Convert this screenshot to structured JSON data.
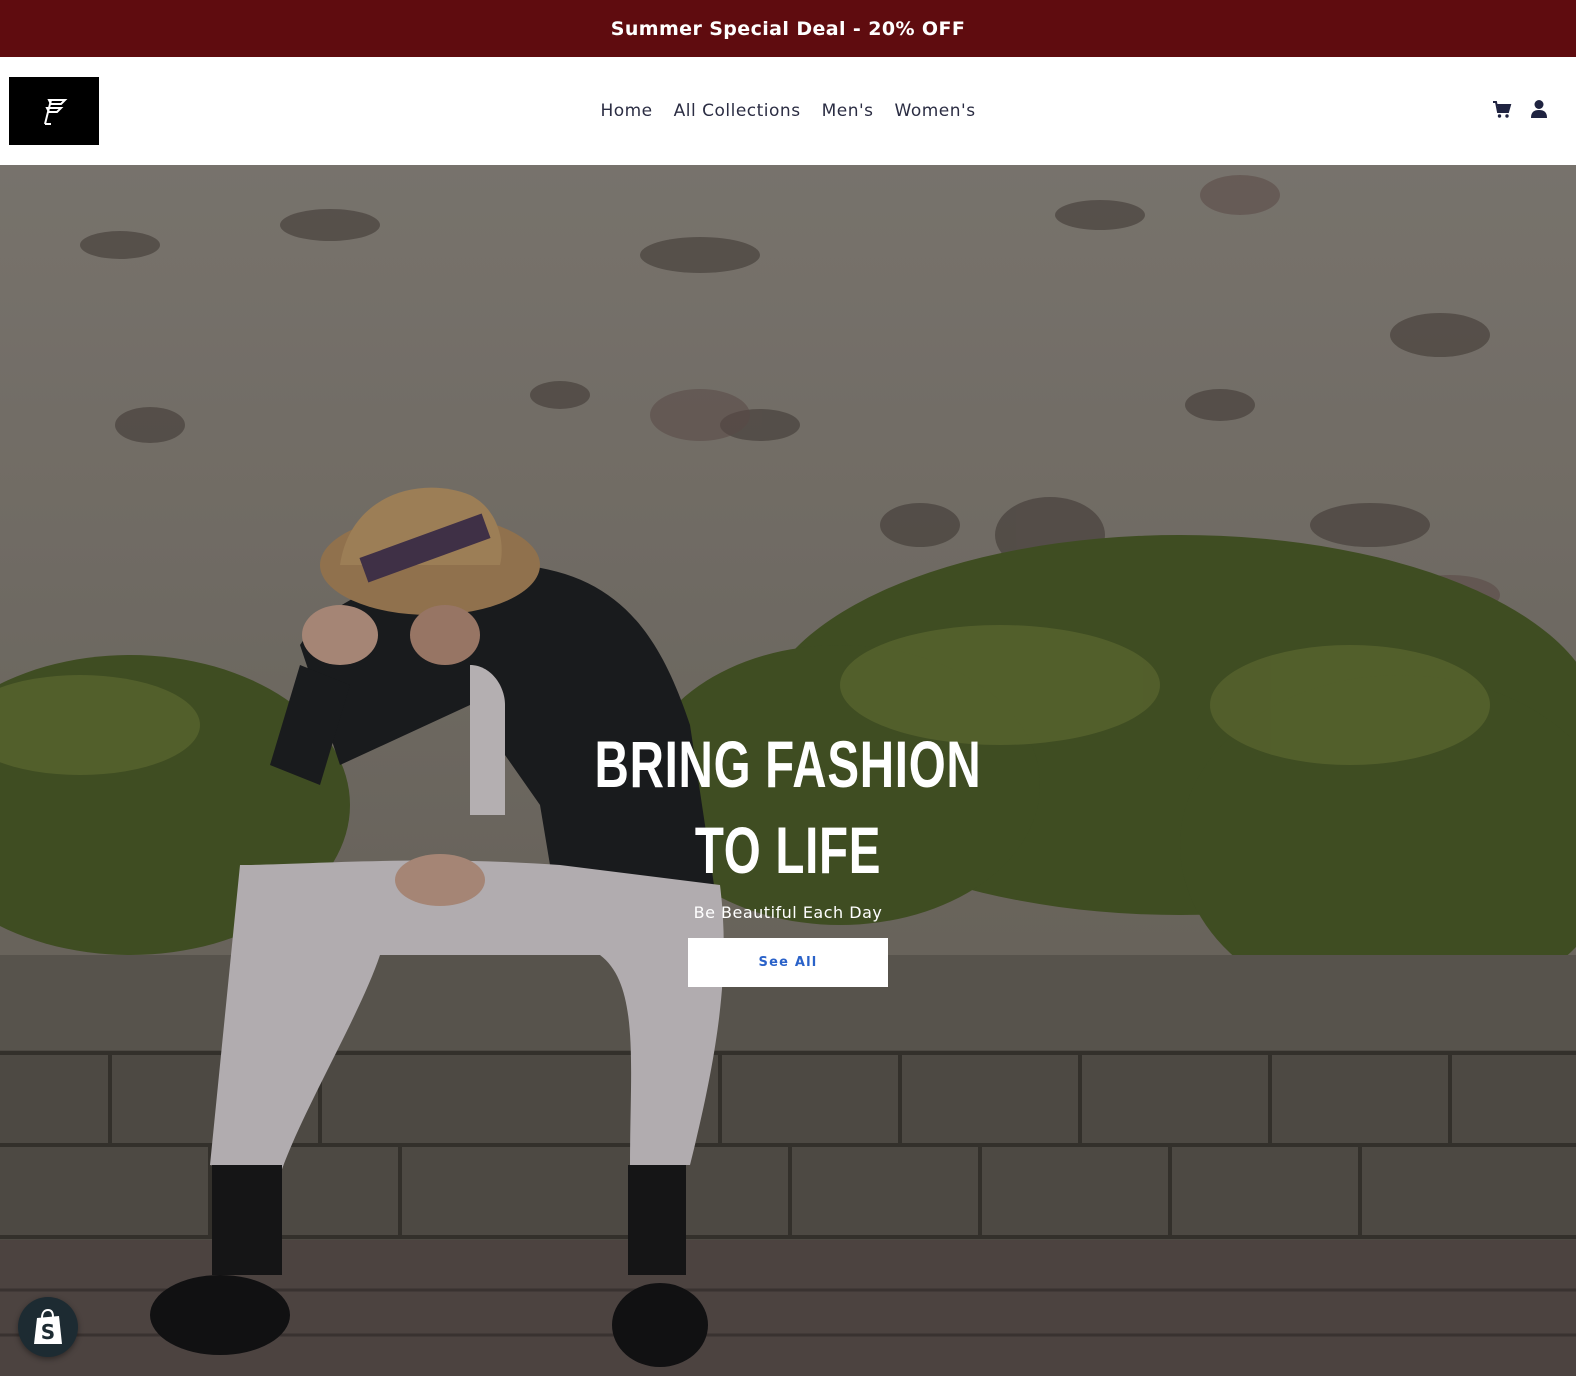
{
  "announcement": {
    "text": "Summer Special Deal - 20% OFF",
    "background": "#5f0c0f"
  },
  "header": {
    "logo_alt": "F",
    "nav": [
      {
        "label": "Home"
      },
      {
        "label": "All Collections"
      },
      {
        "label": "Men's"
      },
      {
        "label": "Women's"
      }
    ],
    "icons": [
      "cart-icon",
      "account-icon"
    ]
  },
  "hero": {
    "title_line1": "BRING FASHION",
    "title_line2": "TO LIFE",
    "subtitle": "Be Beautiful Each Day",
    "cta_label": "See All",
    "cta_color": "#2a62c9"
  },
  "floating": {
    "icon": "shopify-bag-icon"
  }
}
